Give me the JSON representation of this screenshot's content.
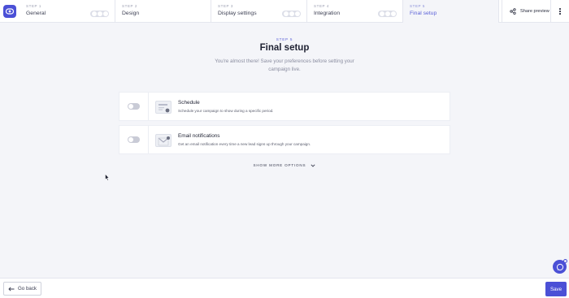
{
  "steps": [
    {
      "number": "STEP 1",
      "title": "General"
    },
    {
      "number": "STEP 2",
      "title": "Design"
    },
    {
      "number": "STEP 3",
      "title": "Display settings"
    },
    {
      "number": "STEP 4",
      "title": "Integration"
    },
    {
      "number": "STEP 5",
      "title": "Final setup"
    }
  ],
  "header": {
    "share_label": "Share preview"
  },
  "main": {
    "eyebrow": "STEP 5",
    "title": "Final setup",
    "subtitle": "You're almost there! Save your preferences before setting your campaign live.",
    "options": [
      {
        "title": "Schedule",
        "description": "Schedule your campaign to show during a specific period.",
        "enabled": false
      },
      {
        "title": "Email notifications",
        "description": "Get an email notification every time a new lead signs up through your campaign.",
        "enabled": false
      }
    ],
    "show_more": "SHOW MORE OPTIONS"
  },
  "footer": {
    "back_label": "Go back",
    "save_label": "Save"
  },
  "colors": {
    "accent": "#4b50d6",
    "active_step_text": "#5d63d8"
  }
}
